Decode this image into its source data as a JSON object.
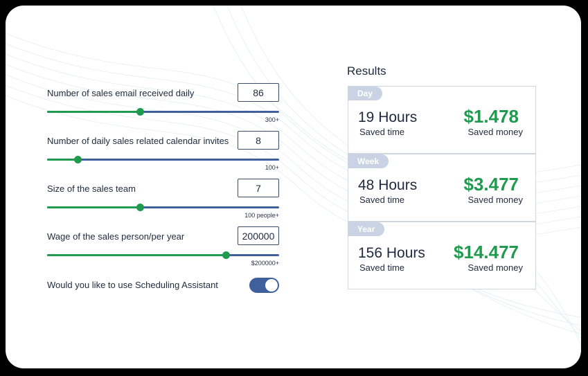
{
  "results_title": "Results",
  "inputs": [
    {
      "label": "Number of sales email received daily",
      "value": "86",
      "max_label": "300+",
      "fill_fraction": 0.4
    },
    {
      "label": "Number of daily sales related calendar invites",
      "value": "8",
      "max_label": "100+",
      "fill_fraction": 0.13
    },
    {
      "label": "Size of the sales team",
      "value": "7",
      "max_label": "100 people+",
      "fill_fraction": 0.4
    },
    {
      "label": "Wage of the sales person/per year",
      "value": "200000",
      "max_label": "$200000+",
      "fill_fraction": 0.77
    }
  ],
  "toggle": {
    "label": "Would you like to use Scheduling Assistant",
    "on": true
  },
  "results": [
    {
      "period": "Day",
      "hours": "19 Hours",
      "hours_caption": "Saved time",
      "money": "$1.478",
      "money_caption": "Saved money"
    },
    {
      "period": "Week",
      "hours": "48 Hours",
      "hours_caption": "Saved time",
      "money": "$3.477",
      "money_caption": "Saved money"
    },
    {
      "period": "Year",
      "hours": "156 Hours",
      "hours_caption": "Saved time",
      "money": "$14.477",
      "money_caption": "Saved money"
    }
  ],
  "colors": {
    "accent_green": "#1f9a4e",
    "slider_blue": "#3f5f9d",
    "tag_bg": "#c9d3e3"
  }
}
